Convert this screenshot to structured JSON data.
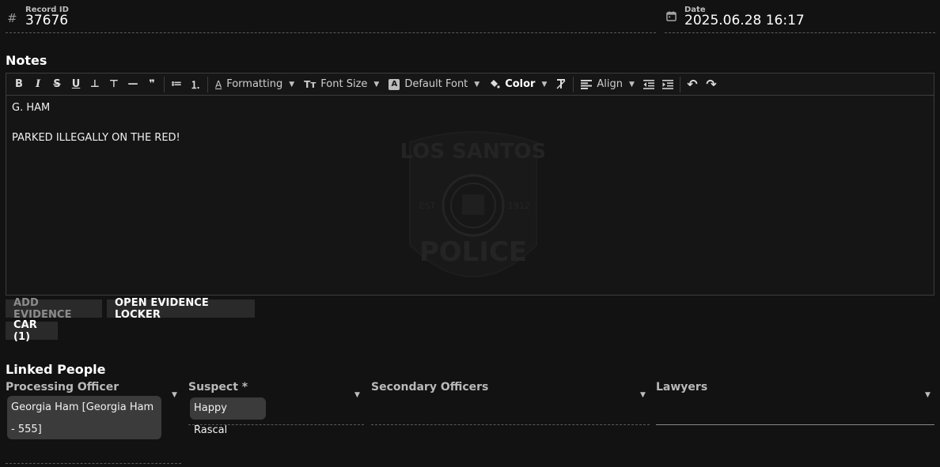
{
  "record": {
    "label": "Record ID",
    "value": "37676",
    "icon": "hash-icon"
  },
  "date": {
    "label": "Date",
    "value": "2025.06.28 16:17",
    "icon": "calendar-icon"
  },
  "notes": {
    "title": "Notes",
    "toolbar": {
      "bold": "B",
      "italic": "I",
      "strike": "S",
      "underline": "U",
      "subscript": "⊥",
      "superscript": "⊤",
      "hr": "—",
      "quote": "❞",
      "bullet_list": "≔",
      "ordered_list": "⒈",
      "formatting": "Formatting",
      "font_size": "Font Size",
      "default_font": "Default Font",
      "default_font_badge": "A",
      "color": "Color",
      "align": "Align",
      "undo": "↶",
      "redo": "↷"
    },
    "body": {
      "line1": "G. HAM",
      "line2": "PARKED ILLEGALLY ON THE RED!"
    },
    "watermark": {
      "top_text": "LOS SANTOS",
      "bottom_text": "POLICE",
      "est": "EST",
      "year": "1912"
    }
  },
  "evidence": {
    "add_label": "ADD EVIDENCE",
    "locker_label": "OPEN EVIDENCE LOCKER",
    "car_label": "CAR (1)"
  },
  "linked": {
    "title": "Linked People",
    "processing_officer": {
      "label": "Processing Officer",
      "value_line1": "Georgia Ham [Georgia Ham",
      "value_line2": "- 555]"
    },
    "suspect": {
      "label": "Suspect *",
      "value": "Happy Rascal"
    },
    "secondary_officers": {
      "label": "Secondary Officers"
    },
    "lawyers": {
      "label": "Lawyers"
    }
  },
  "colors": {
    "background": "#121212",
    "chip": "#3b3b3b",
    "button": "#2a2a2a",
    "border": "#3c3c3c"
  }
}
